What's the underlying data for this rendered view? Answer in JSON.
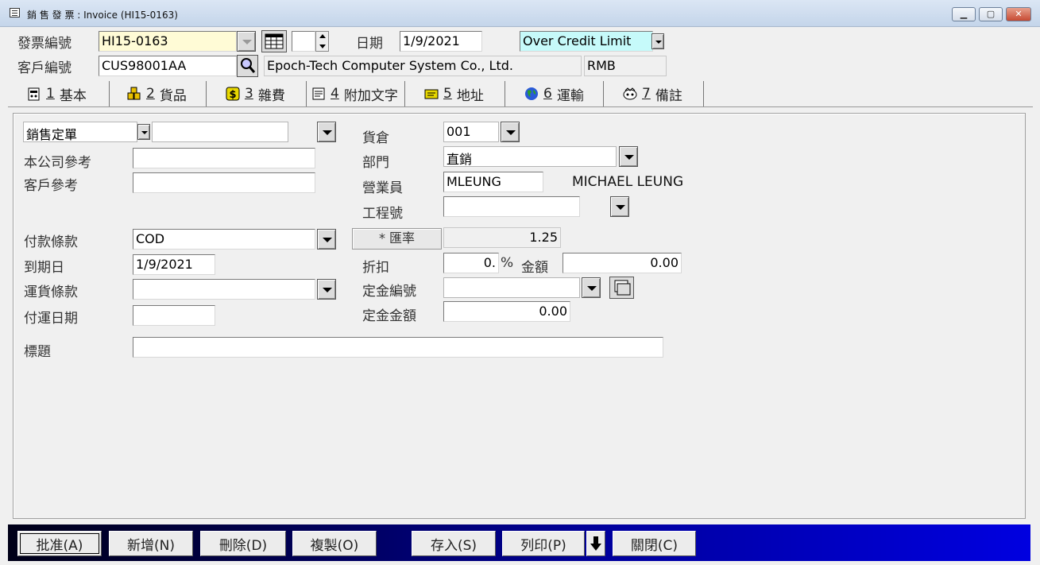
{
  "window": {
    "title": "銷 售 發 票 : Invoice (HI15-0163)",
    "minimize": "▁",
    "maximize": "▢",
    "close": "✕"
  },
  "header": {
    "invoice_no_label": "發票編號",
    "invoice_no": "HI15-0163",
    "date_label": "日期",
    "date": "1/9/2021",
    "status": "Over Credit Limit",
    "customer_no_label": "客戶編號",
    "customer_no": "CUS98001AA",
    "customer_name": "Epoch-Tech Computer System Co., Ltd.",
    "currency": "RMB"
  },
  "tabs": [
    {
      "num": "1",
      "label": "基本",
      "icon": "basic-icon"
    },
    {
      "num": "2",
      "label": "貨品",
      "icon": "goods-icon"
    },
    {
      "num": "3",
      "label": "雜費",
      "icon": "dollar-icon"
    },
    {
      "num": "4",
      "label": "附加文字",
      "icon": "notepad-icon"
    },
    {
      "num": "5",
      "label": "地址",
      "icon": "envelope-icon"
    },
    {
      "num": "6",
      "label": "運輸",
      "icon": "globe-icon"
    },
    {
      "num": "7",
      "label": "備註",
      "icon": "remark-icon"
    }
  ],
  "form": {
    "order_type": "銷售定單",
    "company_ref_label": "本公司參考",
    "customer_ref_label": "客戶參考",
    "payment_terms_label": "付款條款",
    "payment_terms": "COD",
    "due_date_label": "到期日",
    "due_date": "1/9/2021",
    "freight_terms_label": "運貨條款",
    "ship_date_label": "付運日期",
    "subject_label": "標題",
    "warehouse_label": "貨倉",
    "warehouse": "001",
    "department_label": "部門",
    "department": "直銷",
    "salesman_label": "營業員",
    "salesman_code": "MLEUNG",
    "salesman_name": "MICHAEL LEUNG",
    "project_label": "工程號",
    "exchange_rate_label": "* 匯率",
    "exchange_rate": "1.25",
    "discount_label": "折扣",
    "discount": "0.",
    "percent": "%",
    "amount_label": "金額",
    "amount": "0.00",
    "deposit_no_label": "定金編號",
    "deposit_amount_label": "定金金額",
    "deposit_amount": "0.00"
  },
  "toolbar": {
    "approve": "批准(A)",
    "new": "新增(N)",
    "delete": "刪除(D)",
    "copy": "複製(O)",
    "save": "存入(S)",
    "print": "列印(P)",
    "close": "關閉(C)"
  }
}
